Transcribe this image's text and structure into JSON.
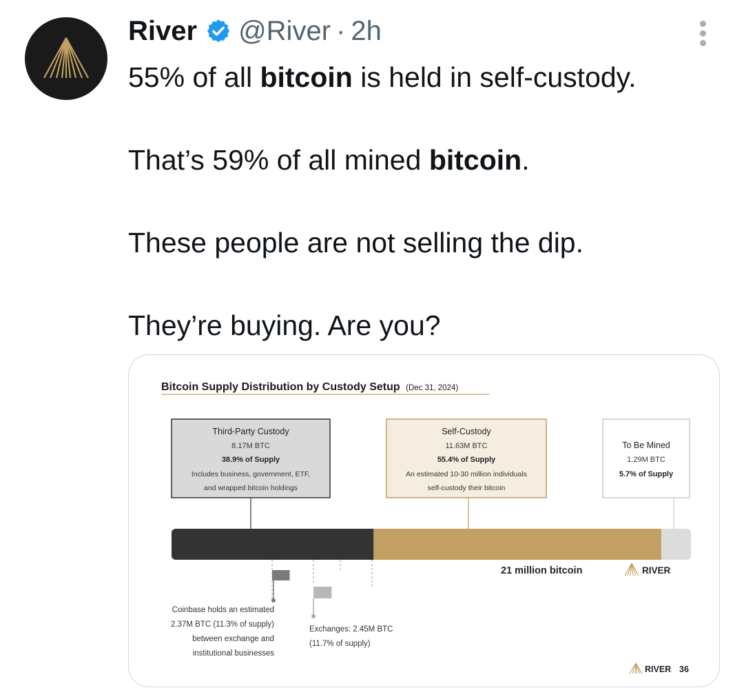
{
  "tweet": {
    "author_name": "River",
    "handle": "@River",
    "separator": "·",
    "time": "2h",
    "text": [
      [
        {
          "t": "55% of all "
        },
        {
          "t": "bitcoin",
          "b": true
        },
        {
          "t": " is held in self-custody."
        }
      ],
      [
        {
          "t": "That’s 59% of all mined "
        },
        {
          "t": "bitcoin",
          "b": true
        },
        {
          "t": "."
        }
      ],
      [
        {
          "t": "These people are not selling the dip."
        }
      ],
      [
        {
          "t": "They’re buying. Are you?"
        }
      ]
    ]
  },
  "icons": {
    "avatar": "river-logo-icon",
    "verified": "verified-badge-icon",
    "more": "more-options-icon"
  },
  "colors": {
    "verified": "#1d9bf0",
    "third_party": "#333333",
    "self_custody": "#c29f62",
    "to_be_mined": "#dcdcdc",
    "brand_gold": "#c29f62"
  },
  "chart": {
    "title": "Bitcoin Supply Distribution by Custody Setup",
    "date": "(Dec 31, 2024)",
    "boxes": {
      "third_party": {
        "title": "Third-Party Custody",
        "btc": "8.17M BTC",
        "pct": "38.9% of Supply",
        "desc1": "Includes business, government, ETF,",
        "desc2": "and wrapped bitcoin holdings"
      },
      "self_custody": {
        "title": "Self-Custody",
        "btc": "11.63M BTC",
        "pct": "55.4% of Supply",
        "desc1": "An estimated 10-30 million individuals",
        "desc2": "self-custody their bitcoin"
      },
      "to_be_mined": {
        "title": "To Be Mined",
        "btc": "1.29M BTC",
        "pct": "5.7% of Supply"
      }
    },
    "total_label": "21 million bitcoin",
    "brand": "RIVER",
    "coinbase_note": [
      "Coinbase holds an estimated",
      "2.37M BTC (11.3% of supply)",
      "between exchange and",
      "institutional businesses"
    ],
    "exchanges_note": [
      "Exchanges: 2.45M BTC",
      "(11.7% of supply)"
    ],
    "footer_brand": "RIVER",
    "page_number": "36"
  },
  "chart_data": {
    "type": "bar",
    "orientation": "horizontal-stacked",
    "title": "Bitcoin Supply Distribution by Custody Setup",
    "subtitle": "(Dec 31, 2024)",
    "series": [
      {
        "name": "Third-Party Custody",
        "values": [
          8.17
        ],
        "percent": 38.9
      },
      {
        "name": "Self-Custody",
        "values": [
          11.63
        ],
        "percent": 55.4
      },
      {
        "name": "To Be Mined",
        "values": [
          1.29
        ],
        "percent": 5.7
      }
    ],
    "total": 21,
    "total_label": "21 million bitcoin",
    "sub_breakdown": [
      {
        "name": "Coinbase",
        "value": 2.37,
        "percent": 11.3
      },
      {
        "name": "Exchanges",
        "value": 2.45,
        "percent": 11.7
      }
    ]
  }
}
